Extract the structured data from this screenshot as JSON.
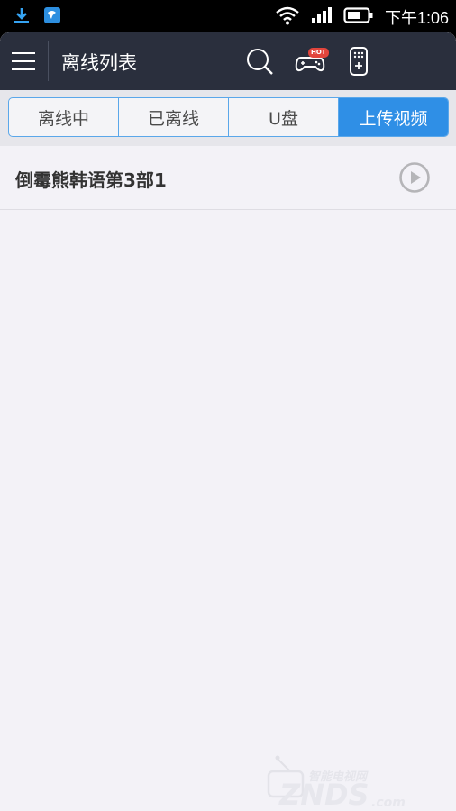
{
  "status_bar": {
    "time": "下午1:06",
    "icons": [
      "download-icon",
      "app-notification-icon",
      "wifi-icon",
      "signal-icon",
      "battery-icon"
    ]
  },
  "header": {
    "title": "离线列表",
    "icons": [
      "menu-icon",
      "search-icon",
      "gamepad-icon",
      "remote-icon"
    ],
    "hot_badge": "HOT"
  },
  "tabs": [
    {
      "label": "离线中",
      "active": false
    },
    {
      "label": "已离线",
      "active": false
    },
    {
      "label": "U盘",
      "active": false
    },
    {
      "label": "上传视频",
      "active": true
    }
  ],
  "list": [
    {
      "title": "倒霉熊韩语第3部1",
      "action_icon": "play-icon"
    }
  ],
  "watermark": {
    "brand": "ZNDS",
    "suffix": ".com",
    "tagline": "智能电视网"
  },
  "colors": {
    "header_bg": "#2a2f3d",
    "accent": "#2f8fe6",
    "background": "#f3f2f7",
    "badge": "#e2453c"
  }
}
